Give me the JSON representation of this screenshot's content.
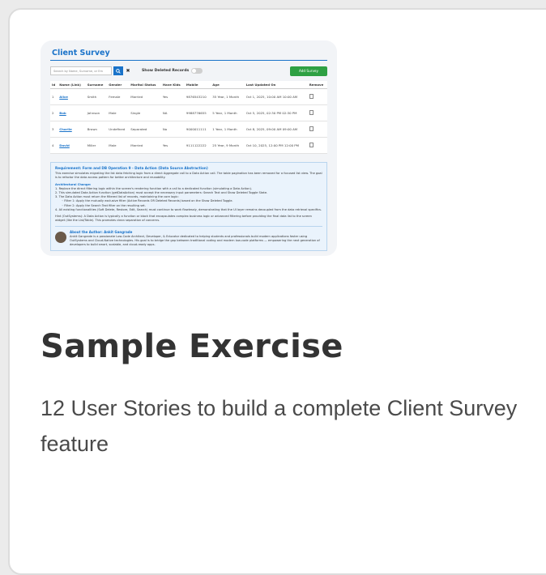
{
  "card": {
    "title": "Sample Exercise",
    "description": "12 User Stories to build a complete Client Survey feature"
  },
  "thumbnail": {
    "title": "Client Survey",
    "search_placeholder": "Search by Name, Surname, or Em",
    "search_icon": "search-icon",
    "clear_label": "✖",
    "toggle_label": "Show Deleted Records",
    "add_button": "Add Survey",
    "columns": [
      "Id",
      "Name (Link)",
      "Surname",
      "Gender",
      "Marital Status",
      "Have Kids",
      "Mobile",
      "Age",
      "Last Updated On",
      "Remove"
    ],
    "rows": [
      [
        "1",
        "Alice",
        "Smith",
        "Female",
        "Married",
        "Yes",
        "9876543210",
        "35 Year, 1 Month",
        "Oct 1, 2025, 10:00 AM 10:00 AM"
      ],
      [
        "2",
        "Bob",
        "Johnson",
        "Male",
        "Single",
        "NA",
        "9988776655",
        "5 Year, 1 Month",
        "Oct 5, 2025, 02:30 PM 02:30 PM"
      ],
      [
        "3",
        "Charlie",
        "Brown",
        "Undefined",
        "Separated",
        "No",
        "9000011111",
        "1 Year, 1 Month",
        "Oct 8, 2025, 09:00 AM 09:00 AM"
      ],
      [
        "4",
        "David",
        "Miller",
        "Male",
        "Married",
        "Yes",
        "9111122222",
        "25 Year, 9 Month",
        "Oct 10, 2025, 12:00 PM 12:00 PM"
      ]
    ],
    "requirement": {
      "heading": "Requirement: Form and DB Operation 9 - Data Action (Data Source Abstraction)",
      "intro": "This exercise simulates migrating the list data fetching logic from a direct Aggregate call to a Data Action call. The table pagination has been removed for a focused list view. The goal is to refactor the data access pattern for better architecture and reusability.",
      "arch_heading": "Architectural Change:",
      "step1": "1. Replace the direct filtering logic within the screen's rendering function with a call to a dedicated function (simulating a Data Action).",
      "step2": "2. This simulated Data Action function (getDataAction) must accept the necessary input parameters: Search Text and Show Deleted Toggle State.",
      "step3": "3. The Data Action must return the filtered list of records, maintaining the core logic:",
      "filter1": "◦ Filter 1: Apply the mutually exclusive filter (Active Records OR Deleted Records) based on the Show Deleted Toggle.",
      "filter2": "◦ Filter 2: Apply the Search Text filter on the resulting set.",
      "step4": "4. All existing functionalities (Soft Delete, Restore, Edit, Search) must continue to work flawlessly, demonstrating that the UI layer remains decoupled from the data retrieval specifics.",
      "hint": "Hint (OutSystems): A Data Action is typically a function or block that encapsulates complex business logic or advanced filtering before providing the final data list to the screen widget (like the List/Table). This promotes clean separation of concerns."
    },
    "author": {
      "name": "About the Author: Ankit Gangrade",
      "bio": "Ankit Gangrade is a passionate Low-Code Architect, Developer, & Educator dedicated to helping students and professionals build modern applications faster using OutSystems and Cloud-Native technologies. His goal is to bridge the gap between traditional coding and modern low-code platforms — empowering the next generation of developers to build smart, scalable, and cloud-ready apps."
    }
  }
}
